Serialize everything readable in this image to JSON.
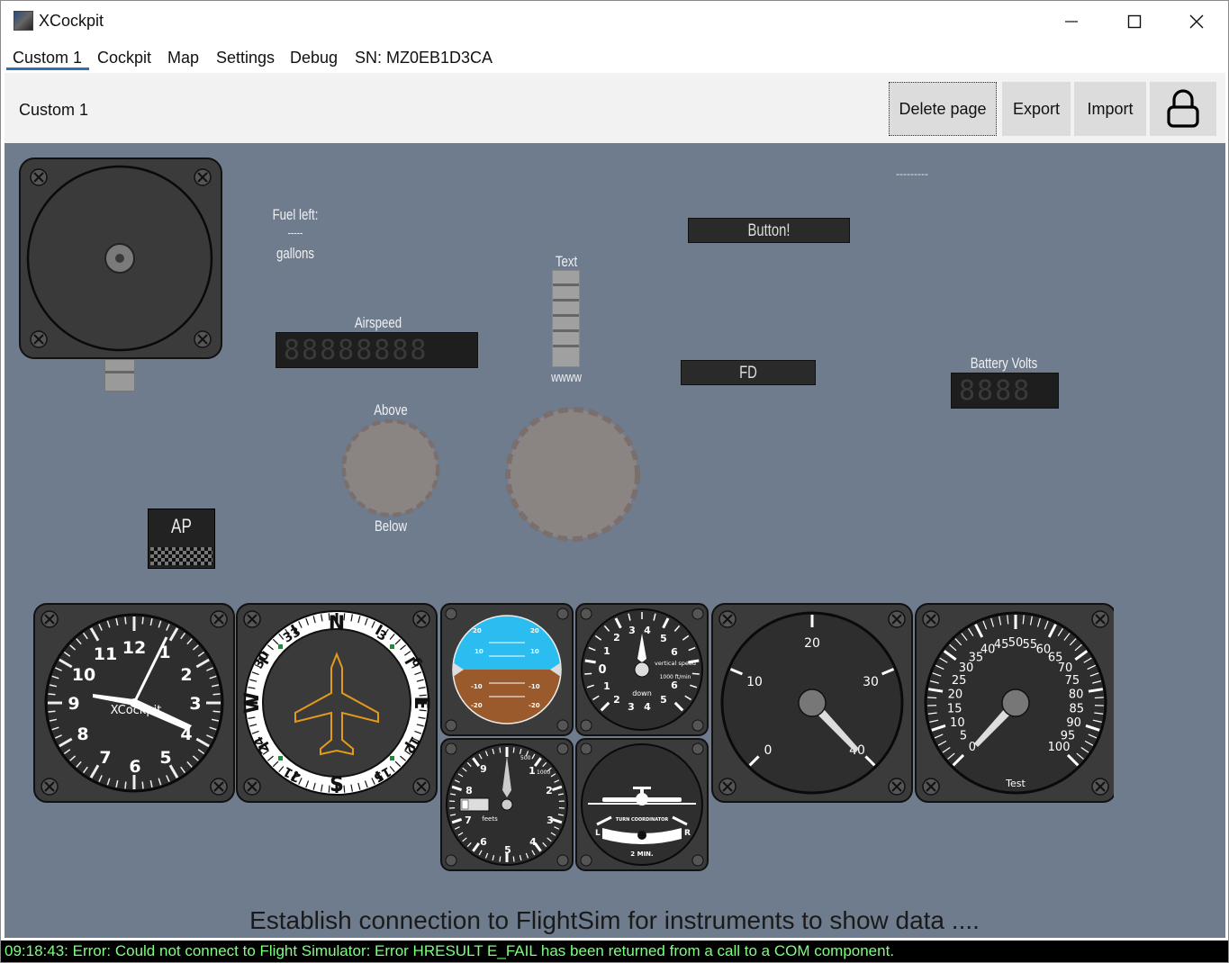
{
  "window": {
    "title": "XCockpit",
    "minimize_icon": "minimize-icon",
    "maximize_icon": "maximize-icon",
    "close_icon": "close-icon"
  },
  "menu": {
    "items": [
      "Custom 1",
      "Cockpit",
      "Map",
      "Settings",
      "Debug",
      "SN: MZ0EB1D3CA"
    ],
    "active": "Custom 1"
  },
  "toolbar": {
    "page_name": "Custom 1",
    "delete_label": "Delete page",
    "export_label": "Export",
    "import_label": "Import",
    "lock_icon": "lock-icon"
  },
  "widgets": {
    "dashes_top_right": "---------",
    "fuel_title": "Fuel left:",
    "fuel_value": "-----",
    "fuel_unit": "gallons",
    "button_label": "Button!",
    "text_title": "Text",
    "text_value": "wwww",
    "airspeed_title": "Airspeed",
    "airspeed_digits": "88888888",
    "fd_label": "FD",
    "battery_title": "Battery Volts",
    "battery_digits": "8888",
    "above_label": "Above",
    "below_label": "Below",
    "ap_label": "AP"
  },
  "instruments": {
    "clock": {
      "numbers": [
        "12",
        "1",
        "2",
        "3",
        "4",
        "5",
        "6",
        "7",
        "8",
        "9",
        "10",
        "11"
      ],
      "label": "XCockpit"
    },
    "heading": {
      "labels": [
        "N",
        "3",
        "6",
        "E",
        "12",
        "15",
        "S",
        "21",
        "24",
        "W",
        "30",
        "33"
      ]
    },
    "attitude": {
      "pitch_labels": [
        "20",
        "10",
        "-10",
        "-20"
      ]
    },
    "vsi": {
      "labels": [
        "0",
        "1",
        "2",
        "3",
        "4",
        "5",
        "6"
      ],
      "up_label": "up",
      "down_label": "down",
      "unit": "vertical speed",
      "unit2": "1000 ft/min"
    },
    "altimeter": {
      "labels": [
        "0",
        "1",
        "2",
        "3",
        "4",
        "5",
        "6",
        "7",
        "8",
        "9"
      ],
      "small_labels": [
        "500",
        "1000"
      ],
      "unit": "feets"
    },
    "turn_coordinator": {
      "title": "TURN COORDINATOR",
      "left": "L",
      "right": "R",
      "time": "2 MIN."
    },
    "gauge40": {
      "labels": [
        "0",
        "10",
        "20",
        "30",
        "40"
      ]
    },
    "gauge100": {
      "labels": [
        "0",
        "5",
        "10",
        "15",
        "20",
        "25",
        "30",
        "35",
        "40",
        "45",
        "50",
        "55",
        "60",
        "65",
        "70",
        "75",
        "80",
        "85",
        "90",
        "95",
        "100"
      ],
      "title": "Test"
    }
  },
  "status": {
    "message": "Establish connection to FlightSim for instruments to show data ....",
    "log": "09:18:43: Error: Could not connect to Flight Simulator: Error HRESULT E_FAIL has been returned from a call to a COM component."
  },
  "colors": {
    "canvas": "#6e7c8e",
    "accent": "#2a6fb8",
    "log_text": "#7cff7c"
  }
}
